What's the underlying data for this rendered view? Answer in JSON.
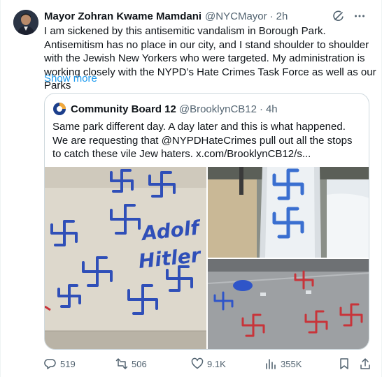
{
  "tweet": {
    "author_name": "Mayor Zohran Kwame Mamdani",
    "author_handle": "@NYCMayor",
    "separator": "·",
    "time": "2h",
    "text": "I am sickened by this antisemitic vandalism in Borough Park. Antisemitism has no place in our city, and I stand shoulder to shoulder with the Jewish New Yorkers who were targeted. My administration is working closely with the NYPD’s Hate Crimes Task Force as well as our Parks",
    "show_more": "Show more",
    "header_icons": [
      "grok-icon",
      "more-icon"
    ]
  },
  "quote": {
    "author_name": "Community Board 12",
    "author_handle": "@BrooklynCB12",
    "separator": "·",
    "time": "4h",
    "text": "Same park different day. A day later and this is what happened. We are requesting that @NYPDHateCrimes pull out all the stops to catch these vile Jew haters.  x.com/BrooklynCB12/s...",
    "media": [
      {
        "name": "vandalized-wall-photo",
        "painted_text": "Adolf Hitler"
      },
      {
        "name": "vandalized-slide-photo"
      },
      {
        "name": "vandalized-pavement-photo"
      }
    ]
  },
  "actions": {
    "replies": "519",
    "reposts": "506",
    "likes": "9.1K",
    "views": "355K"
  },
  "colors": {
    "text": "#0f1419",
    "secondary": "#536471",
    "link": "#1d9bf0",
    "border": "#cfd9de",
    "paint_blue": "#2f4fb8",
    "paint_red": "#c8343a"
  }
}
